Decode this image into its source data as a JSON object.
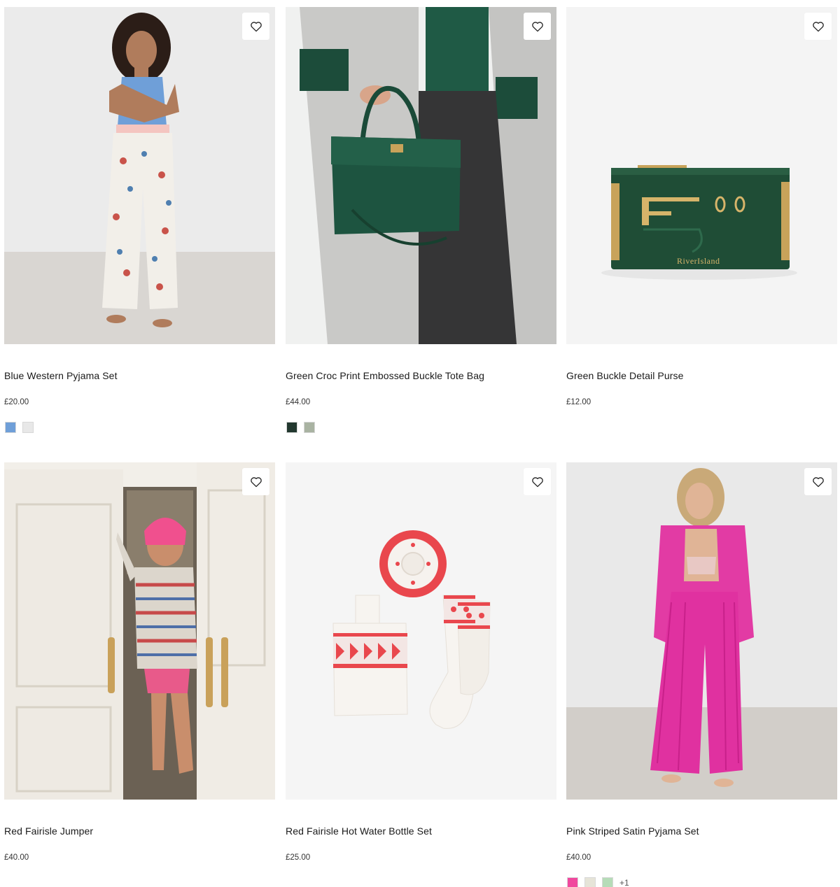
{
  "products": [
    {
      "title": "Blue Western Pyjama Set",
      "price": "£20.00",
      "swatches": [
        "#6f9fd8",
        "#e8e8e8"
      ],
      "more": ""
    },
    {
      "title": "Green Croc Print Embossed Buckle Tote Bag",
      "price": "£44.00",
      "swatches": [
        "#22382f",
        "#a9b3a2"
      ],
      "more": ""
    },
    {
      "title": "Green Buckle Detail Purse",
      "price": "£12.00",
      "swatches": [],
      "more": ""
    },
    {
      "title": "Red Fairisle Jumper",
      "price": "£40.00",
      "swatches": [],
      "more": ""
    },
    {
      "title": "Red Fairisle Hot Water Bottle Set",
      "price": "£25.00",
      "swatches": [],
      "more": ""
    },
    {
      "title": "Pink Striped Satin Pyjama Set",
      "price": "£40.00",
      "swatches": [
        "#f0489e",
        "#e6e4d8",
        "#b6dcb8"
      ],
      "more": "+1"
    }
  ],
  "icons": {
    "wishlist": "heart-outline-icon"
  },
  "logo_text": "RiverIsland"
}
